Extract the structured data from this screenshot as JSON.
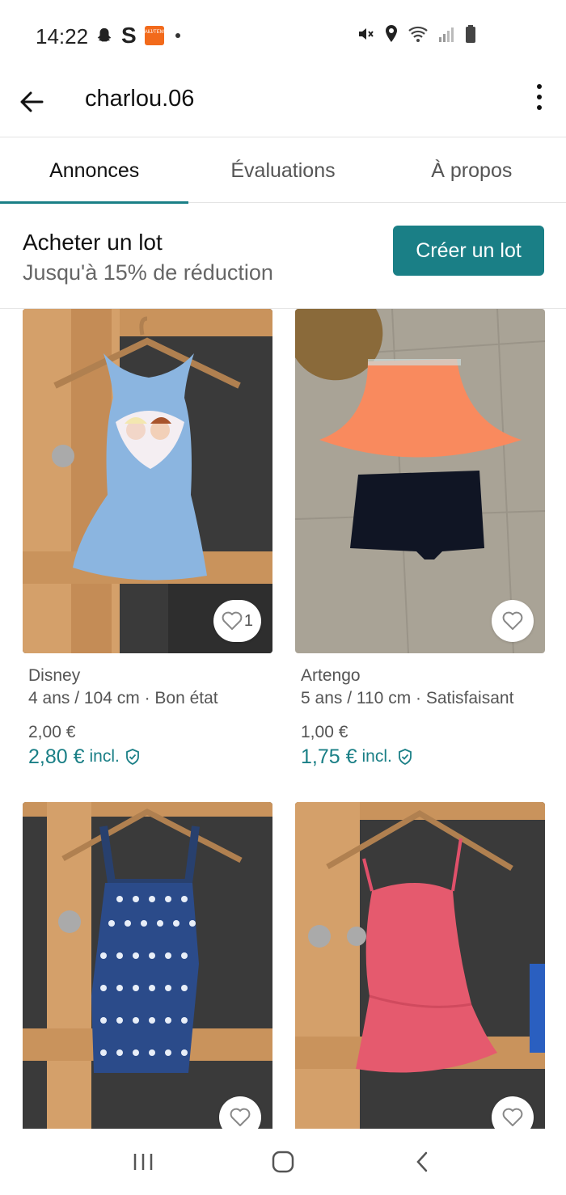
{
  "status_bar": {
    "time": "14:22",
    "left_icons": [
      "ghost-icon",
      "s-app-icon",
      "temu-app-icon",
      "notification-dot-icon"
    ],
    "temu_label": "AliJ/TEMU",
    "s_label": "S",
    "right_icons": [
      "mute-icon",
      "location-icon",
      "wifi-icon",
      "signal-icon",
      "battery-icon"
    ]
  },
  "app_bar": {
    "username": "charlou.06",
    "back_icon": "arrow-left-icon",
    "more_icon": "more-vertical-icon"
  },
  "tabs": [
    {
      "label": "Annonces",
      "active": true
    },
    {
      "label": "Évaluations",
      "active": false
    },
    {
      "label": "À propos",
      "active": false
    }
  ],
  "bundle": {
    "title": "Acheter un lot",
    "subtitle": "Jusqu'à 15% de réduction",
    "button_label": "Créer un lot"
  },
  "items": [
    {
      "brand": "Disney",
      "meta": "4 ans / 104 cm · Bon état",
      "price": "2,00 €",
      "price_incl": "2,80 €",
      "incl_label": "incl.",
      "favorites": "1"
    },
    {
      "brand": "Artengo",
      "meta": "5 ans / 110 cm · Satisfaisant",
      "price": "1,00 €",
      "price_incl": "1,75 €",
      "incl_label": "incl.",
      "favorites": ""
    },
    {
      "brand": "",
      "meta": "",
      "price": "",
      "price_incl": "",
      "incl_label": "",
      "favorites": ""
    },
    {
      "brand": "",
      "meta": "",
      "price": "",
      "price_incl": "",
      "incl_label": "",
      "favorites": ""
    }
  ],
  "colors": {
    "accent": "#1a7f86",
    "text_primary": "#111111",
    "text_secondary": "#555555"
  },
  "nav_bar": {
    "icons": [
      "recent-apps-icon",
      "home-icon",
      "back-nav-icon"
    ]
  }
}
